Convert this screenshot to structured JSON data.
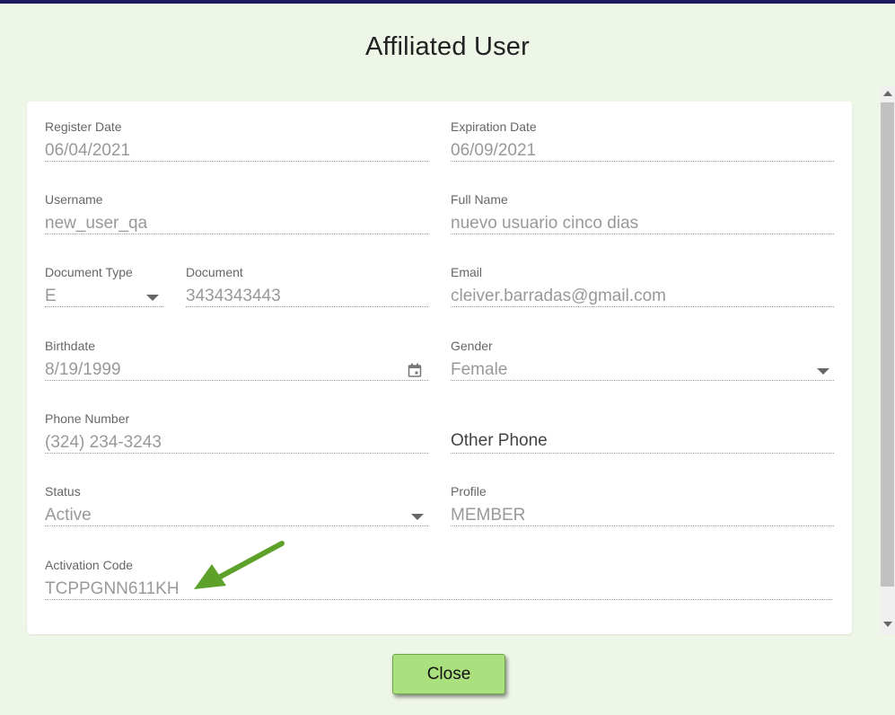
{
  "dialog": {
    "title": "Affiliated User",
    "close_label": "Close"
  },
  "fields": {
    "register_date": {
      "label": "Register Date",
      "value": "06/04/2021"
    },
    "expiration_date": {
      "label": "Expiration Date",
      "value": "06/09/2021"
    },
    "username": {
      "label": "Username",
      "value": "new_user_qa"
    },
    "full_name": {
      "label": "Full Name",
      "value": "nuevo usuario cinco dias"
    },
    "document_type": {
      "label": "Document Type",
      "value": "E"
    },
    "document": {
      "label": "Document",
      "value": "3434343443"
    },
    "email": {
      "label": "Email",
      "value": "cleiver.barradas@gmail.com"
    },
    "birthdate": {
      "label": "Birthdate",
      "value": "8/19/1999"
    },
    "gender": {
      "label": "Gender",
      "value": "Female"
    },
    "phone_number": {
      "label": "Phone Number",
      "value": "(324) 234-3243"
    },
    "other_phone": {
      "label": "Other Phone",
      "value": ""
    },
    "status": {
      "label": "Status",
      "value": "Active"
    },
    "profile": {
      "label": "Profile",
      "value": "MEMBER"
    },
    "activation_code": {
      "label": "Activation Code",
      "value": "TCPPGNN611KH"
    }
  },
  "icons": {
    "calendar": "calendar-icon",
    "dropdown": "chevron-down-icon",
    "annotation": "green-arrow-annotation"
  },
  "colors": {
    "background": "#eef6e8",
    "button": "#abe07f",
    "arrow": "#5ea12a",
    "top_bar": "#1c1a5e"
  }
}
